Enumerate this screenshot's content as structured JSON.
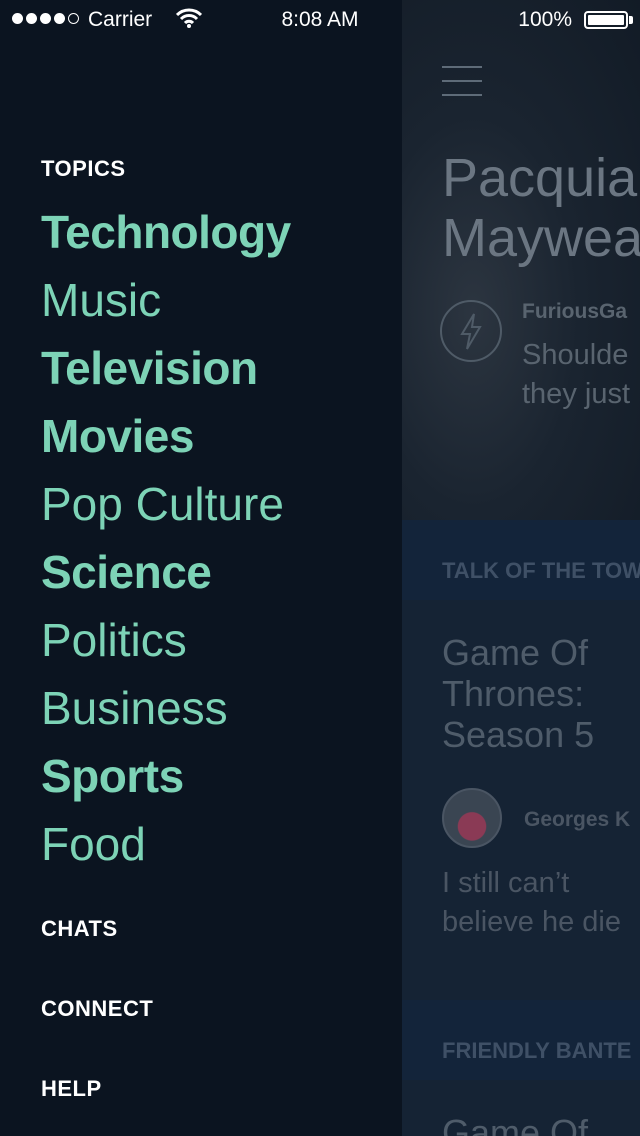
{
  "status_bar": {
    "carrier": "Carrier",
    "time": "8:08 AM",
    "battery": "100%",
    "battery_level": 1.0
  },
  "menu": {
    "topics_header": "TOPICS",
    "topics": [
      {
        "label": "Technology",
        "weight": "bold"
      },
      {
        "label": "Music",
        "weight": "light"
      },
      {
        "label": "Television",
        "weight": "bold"
      },
      {
        "label": "Movies",
        "weight": "bold"
      },
      {
        "label": "Pop Culture",
        "weight": "light"
      },
      {
        "label": "Science",
        "weight": "bold"
      },
      {
        "label": "Politics",
        "weight": "light"
      },
      {
        "label": "Business",
        "weight": "light"
      },
      {
        "label": "Sports",
        "weight": "bold"
      },
      {
        "label": "Food",
        "weight": "light"
      }
    ],
    "chats": "CHATS",
    "connect": "CONNECT",
    "help": "HELP"
  },
  "content": {
    "hero": {
      "title": "Pacquia\nMaywea",
      "user": "FuriousGa",
      "message": "Shoulde\nthey just"
    },
    "section1": "TALK OF THE TOW",
    "card1": {
      "title": "Game Of\nThrones:\nSeason 5",
      "user": "Georges K",
      "message": "I still can’t\nbelieve he die"
    },
    "section2": "FRIENDLY BANTE",
    "card2": {
      "title": "Game Of"
    }
  },
  "colors": {
    "menu_background": "#0b1420",
    "topic_text": "#7dd3b6",
    "header_text": "#ffffff"
  }
}
